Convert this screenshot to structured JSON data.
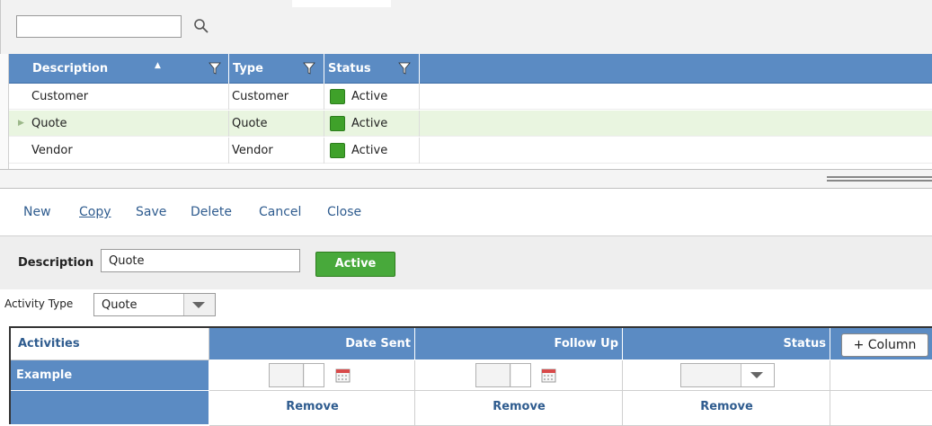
{
  "search": {
    "value": "",
    "placeholder": ""
  },
  "grid": {
    "columns": [
      {
        "label": "Description"
      },
      {
        "label": "Type"
      },
      {
        "label": "Status"
      }
    ],
    "rows": [
      {
        "description": "Customer",
        "type": "Customer",
        "status": "Active"
      },
      {
        "description": "Quote",
        "type": "Quote",
        "status": "Active",
        "selected": true
      },
      {
        "description": "Vendor",
        "type": "Vendor",
        "status": "Active"
      }
    ]
  },
  "toolbar": {
    "new": "New",
    "copy": "Copy",
    "save": "Save",
    "delete": "Delete",
    "cancel": "Cancel",
    "close": "Close"
  },
  "form": {
    "description_label": "Description",
    "description_value": "Quote",
    "active_button": "Active",
    "activity_type_label": "Activity Type",
    "activity_type_value": "Quote"
  },
  "activities_table": {
    "header_label": "Activities",
    "columns": [
      {
        "label": "Date Sent"
      },
      {
        "label": "Follow Up"
      },
      {
        "label": "Status"
      }
    ],
    "add_column_button": "+ Column",
    "example_label": "Example",
    "remove_labels": [
      "Remove",
      "Remove",
      "Remove"
    ]
  },
  "colors": {
    "header_blue": "#5b8bc3",
    "active_green": "#48a93b",
    "link_blue": "#2f5c8f",
    "selected_row": "#e9f5e0"
  }
}
